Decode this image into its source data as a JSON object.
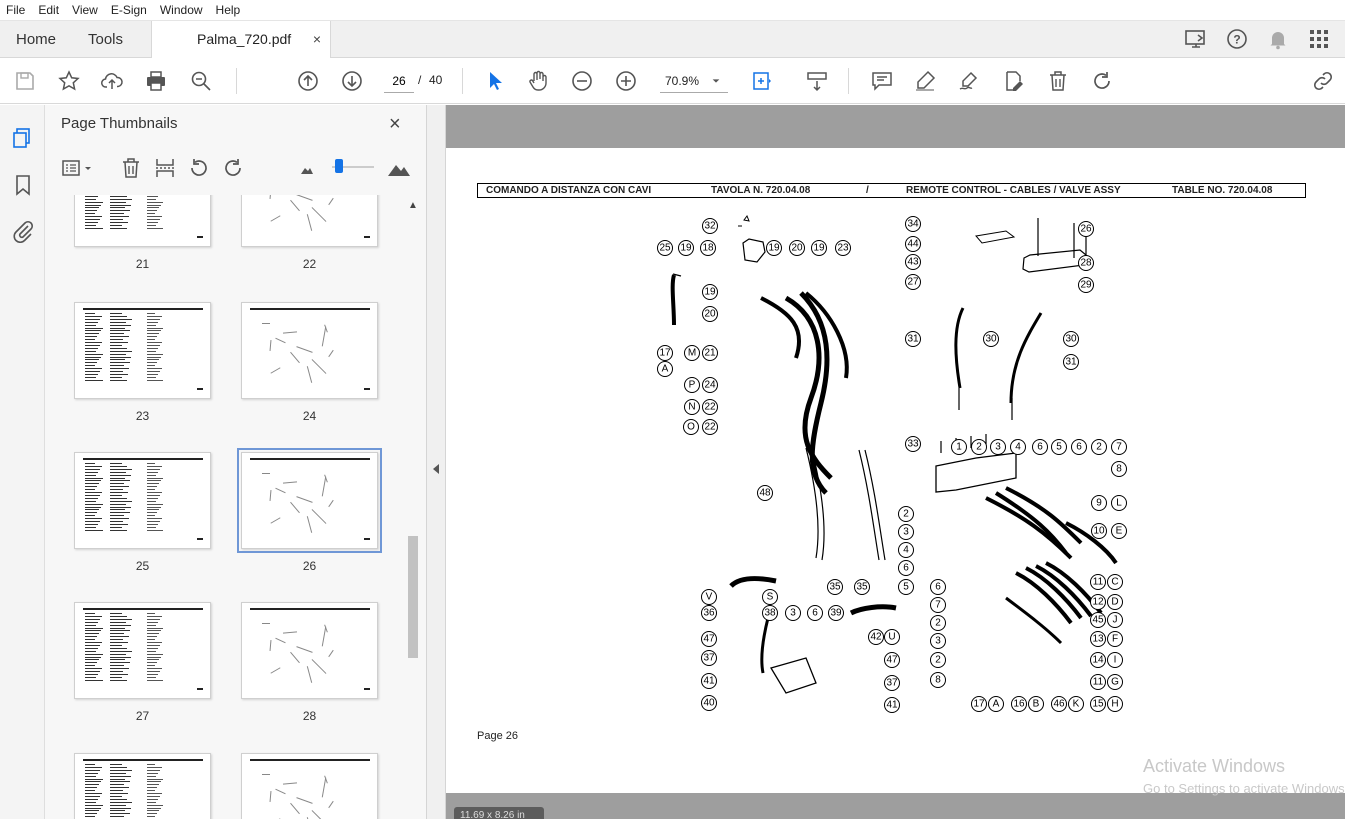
{
  "menu": [
    "File",
    "Edit",
    "View",
    "E-Sign",
    "Window",
    "Help"
  ],
  "tabs": {
    "home": "Home",
    "tools": "Tools",
    "document": "Palma_720.pdf",
    "close": "×"
  },
  "nav": {
    "page_current": "26",
    "page_separator": "/",
    "page_total": "40",
    "zoom": "70.9%"
  },
  "panel": {
    "title": "Page Thumbnails",
    "close": "×",
    "thumbnails": [
      {
        "label": "21"
      },
      {
        "label": "22"
      },
      {
        "label": "23"
      },
      {
        "label": "24"
      },
      {
        "label": "25"
      },
      {
        "label": "26",
        "selected": true
      },
      {
        "label": "27"
      },
      {
        "label": "28"
      },
      {
        "label": ""
      },
      {
        "label": ""
      }
    ]
  },
  "document": {
    "header": {
      "left": "COMANDO A DISTANZA CON CAVI",
      "table_it": "TAVOLA N. 720.04.08",
      "slash": "/",
      "right": "REMOTE CONTROL - CABLES / VALVE ASSY",
      "table_en": "TABLE NO. 720.04.08"
    },
    "page_label": "Page 26",
    "page_size": "11.69 x 8.26 in",
    "part_labels": [
      "32",
      "25",
      "19",
      "18",
      "19",
      "20",
      "19",
      "23",
      "19",
      "20",
      "17",
      "A",
      "M",
      "21",
      "P",
      "24",
      "N",
      "22",
      "O",
      "22",
      "48",
      "35",
      "35",
      "34",
      "26",
      "44",
      "43",
      "27",
      "28",
      "29",
      "30",
      "30",
      "31",
      "31",
      "33",
      "1",
      "2",
      "3",
      "4",
      "6",
      "5",
      "6",
      "2",
      "7",
      "8",
      "9",
      "L",
      "10",
      "E",
      "2",
      "3",
      "4",
      "6",
      "5",
      "6",
      "7",
      "2",
      "3",
      "2",
      "8",
      "11",
      "C",
      "12",
      "D",
      "45",
      "J",
      "13",
      "F",
      "14",
      "I",
      "11",
      "G",
      "17",
      "A",
      "16",
      "B",
      "46",
      "K",
      "15",
      "H",
      "V",
      "S",
      "36",
      "38",
      "3",
      "6",
      "39",
      "42",
      "U",
      "47",
      "47",
      "37",
      "37",
      "41",
      "41",
      "40"
    ]
  },
  "watermark": {
    "line1": "Activate Windows",
    "line2": "Go to Settings to activate Windows."
  },
  "colors": {
    "accent": "#1473e6",
    "viewer_bg": "#9e9e9e"
  }
}
